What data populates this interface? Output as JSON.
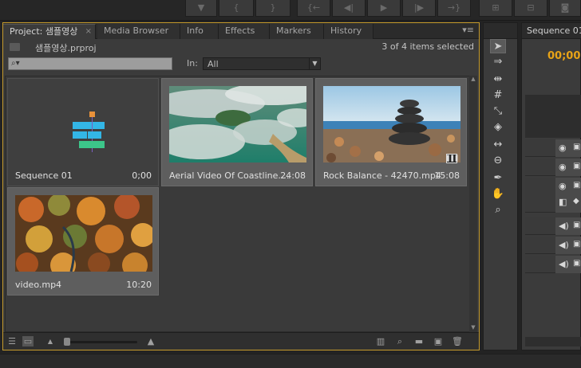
{
  "project_panel": {
    "tabs": [
      {
        "label": "Project: 샘플영상",
        "active": true
      },
      {
        "label": "Media Browser"
      },
      {
        "label": "Info"
      },
      {
        "label": "Effects"
      },
      {
        "label": "Markers"
      },
      {
        "label": "History"
      }
    ],
    "tab_close_glyph": "×",
    "panel_menu_glyph": "▾≡",
    "project_file": "샘플영상.prproj",
    "selection_status": "3 of 4 items selected",
    "search_placeholder": "",
    "in_label": "In:",
    "in_value": "All",
    "items": [
      {
        "name": "Sequence 01",
        "duration": "0;00",
        "kind": "sequence",
        "selected": false
      },
      {
        "name": "Aerial Video Of Coastline....",
        "duration": "24:08",
        "kind": "video",
        "selected": true
      },
      {
        "name": "Rock Balance - 42470.mp4",
        "duration": "15:08",
        "kind": "video",
        "selected": true,
        "audio_badge": true
      },
      {
        "name": "video.mp4",
        "duration": "10:20",
        "kind": "video",
        "selected": true
      }
    ]
  },
  "tools": [
    "selection-tool",
    "track-select-tool",
    "ripple-edit-tool",
    "rolling-edit-tool",
    "rate-stretch-tool",
    "razor-tool",
    "slip-tool",
    "slide-tool",
    "pen-tool",
    "hand-tool",
    "zoom-tool"
  ],
  "sequence_panel": {
    "tab_title": "Sequence 01",
    "timecode": "00;00;"
  },
  "colors": {
    "accent_border": "#c69b2c",
    "timecode": "#e8a317"
  }
}
